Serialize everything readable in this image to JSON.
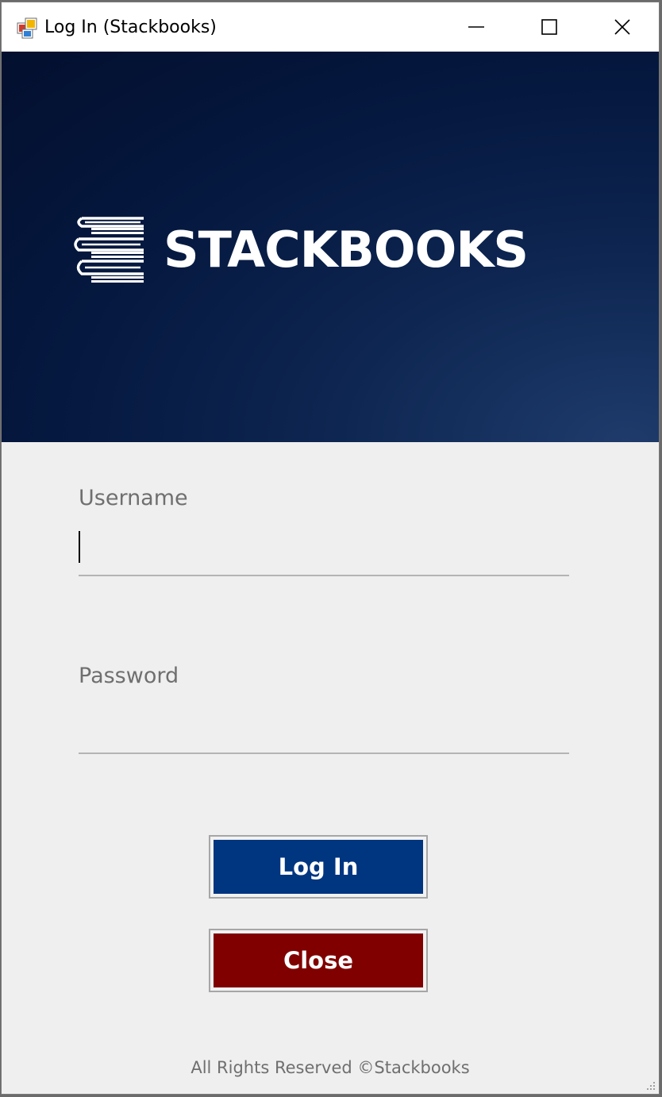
{
  "window": {
    "title": "Log In (Stackbooks)",
    "controls": [
      "minimize",
      "maximize",
      "close"
    ]
  },
  "banner": {
    "brand_name": "STACKBOOKS",
    "logo_icon": "book-stack-icon"
  },
  "form": {
    "username_label": "Username",
    "username_value": "",
    "password_label": "Password",
    "password_value": "",
    "login_label": "Log In",
    "close_label": "Close"
  },
  "footer": {
    "text": "All Rights Reserved ©Stackbooks"
  },
  "colors": {
    "banner_dark": "#030f2e",
    "banner_light": "#1e3b6b",
    "login_button": "#003580",
    "close_button": "#800000",
    "form_background": "#efefef"
  }
}
